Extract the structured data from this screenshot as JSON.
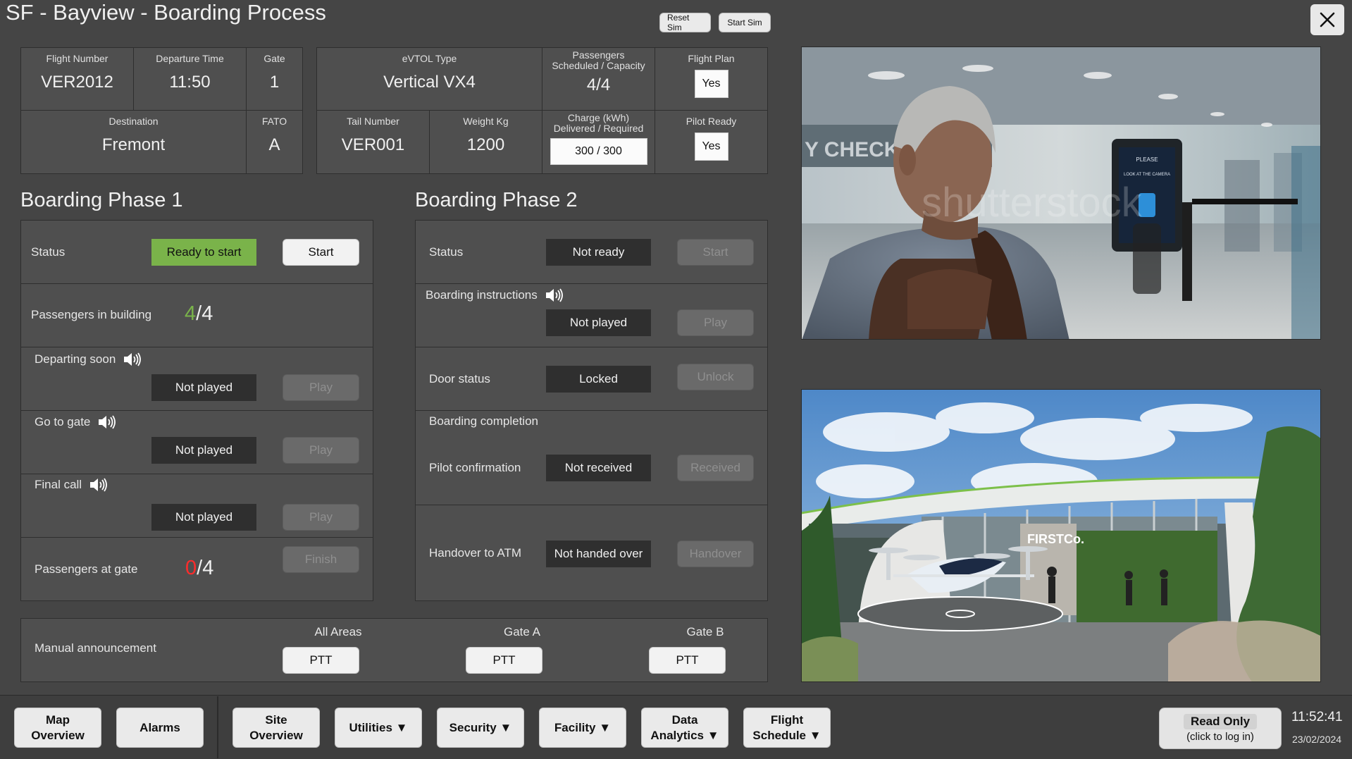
{
  "app": {
    "title": "SF - Bayview - Boarding Process",
    "reset_sim": "Reset Sim",
    "start_sim": "Start Sim"
  },
  "flight": {
    "flight_number_label": "Flight Number",
    "flight_number": "VER2012",
    "departure_time_label": "Departure Time",
    "departure_time": "11:50",
    "gate_label": "Gate",
    "gate": "1",
    "destination_label": "Destination",
    "destination": "Fremont",
    "fato_label": "FATO",
    "fato": "A"
  },
  "aircraft": {
    "type_label": "eVTOL Type",
    "type": "Vertical VX4",
    "passengers_label_line1": "Passengers",
    "passengers_label_line2": "Scheduled / Capacity",
    "passengers": "4/4",
    "flight_plan_label": "Flight Plan",
    "flight_plan": "Yes",
    "tail_number_label": "Tail Number",
    "tail_number": "VER001",
    "weight_label": "Weight Kg",
    "weight": "1200",
    "charge_label_line1": "Charge (kWh)",
    "charge_label_line2": "Delivered / Required",
    "charge": "300 / 300",
    "pilot_ready_label": "Pilot Ready",
    "pilot_ready": "Yes"
  },
  "phase1": {
    "title": "Boarding Phase 1",
    "status_label": "Status",
    "status": "Ready to start",
    "start_button": "Start",
    "passengers_in_building_label": "Passengers in building",
    "passengers_in_building_count": "4",
    "passengers_in_building_total": "/4",
    "departing_soon_label": "Departing soon",
    "departing_soon_status": "Not played",
    "go_to_gate_label": "Go to gate",
    "go_to_gate_status": "Not played",
    "final_call_label": "Final call",
    "final_call_status": "Not played",
    "play_button": "Play",
    "passengers_at_gate_label": "Passengers at gate",
    "passengers_at_gate_count": "0",
    "passengers_at_gate_total": "/4",
    "finish_button": "Finish"
  },
  "phase2": {
    "title": "Boarding Phase 2",
    "status_label": "Status",
    "status": "Not ready",
    "start_button": "Start",
    "instructions_label": "Boarding instructions",
    "instructions_status": "Not played",
    "play_button": "Play",
    "door_label": "Door status",
    "door_status": "Locked",
    "unlock_button": "Unlock",
    "completion_label": "Boarding completion",
    "pilot_confirmation_label": "Pilot confirmation",
    "pilot_confirmation_status": "Not received",
    "received_button": "Received",
    "handover_label": "Handover to ATM",
    "handover_status": "Not handed over",
    "handover_button": "Handover"
  },
  "announcement": {
    "label": "Manual announcement",
    "all_areas": "All Areas",
    "gate_a": "Gate A",
    "gate_b": "Gate B",
    "ptt": "PTT"
  },
  "images": {
    "photo1_watermark": "shutterstock",
    "photo1_sign": "Y CHECK",
    "photo1_kiosk_line1": "PLEASE",
    "photo1_kiosk_line2": "LOOK AT THE CAMERA",
    "photo2_sign": "FIRSTCo."
  },
  "nav": {
    "map_overview": "Map\nOverview",
    "alarms": "Alarms",
    "site_overview": "Site\nOverview",
    "utilities": "Utilities ▼",
    "security": "Security ▼",
    "facility": "Facility ▼",
    "data_analytics": "Data\nAnalytics ▼",
    "flight_schedule": "Flight\nSchedule ▼"
  },
  "session": {
    "read_only": "Read Only",
    "login_hint": "(click to log in)",
    "time": "11:52:41",
    "date": "23/02/2024"
  },
  "colors": {
    "background": "#454545",
    "panel": "#4f4f4f",
    "ready_green": "#7ab34a",
    "count_green": "#7ab34a",
    "count_red": "#ff2b2b"
  },
  "icons": {
    "speaker": "speaker-icon",
    "close": "close-icon"
  }
}
